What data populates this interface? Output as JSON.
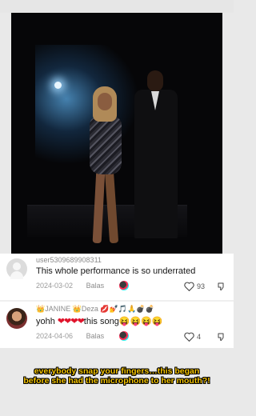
{
  "video": {
    "description_icon": "concert-video-frame"
  },
  "comments": [
    {
      "username": "user5309689908311",
      "text": "This whole performance is so underrated",
      "date": "2024-03-02",
      "reply_label": "Balas",
      "likes": "93"
    },
    {
      "username": "👑JANINE 👑Deza 💋💅🎵🙏💣💣",
      "text_before": "yohh ",
      "hearts": "❤❤❤❤",
      "text_mid": "this song",
      "emojis": "😝😝😝😝",
      "date": "2024-04-06",
      "reply_label": "Balas",
      "likes": "4"
    }
  ],
  "caption": {
    "line1": "everybody snap your fingers…this began",
    "line2": "before she had the microphone to her mouth?!"
  },
  "colors": {
    "caption": "#f5c400",
    "heart": "#e0142b"
  }
}
